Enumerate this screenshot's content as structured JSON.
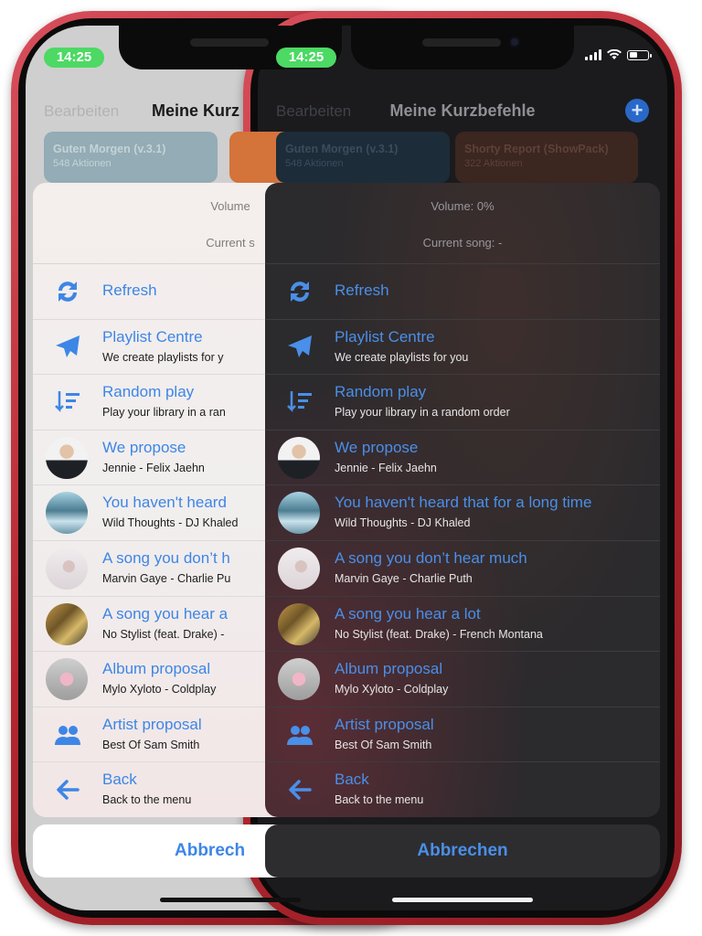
{
  "colors": {
    "accent": "#3d86e6",
    "phone_frame": "#c0303a",
    "time_pill": "#4cd964"
  },
  "status_bar": {
    "time": "14:25"
  },
  "nav": {
    "edit_label": "Bearbeiten",
    "title_dark": "Meine Kurzbefehle",
    "title_light": "Meine Kurz",
    "plus_icon": "+"
  },
  "tiles": [
    {
      "title": "Guten Morgen (v.3.1)",
      "subtitle": "548 Aktionen"
    },
    {
      "title": "Shorty Report (ShowPack)",
      "subtitle": "322 Aktionen"
    }
  ],
  "info": {
    "volume": "Volume: 0%",
    "volume_light": "Volume",
    "current_song": "Current song:  -",
    "current_song_light": "Current s"
  },
  "rows_dark": [
    {
      "icon": "refresh-icon",
      "title": "Refresh",
      "subtitle": ""
    },
    {
      "icon": "paper-plane-icon",
      "title": "Playlist Centre",
      "subtitle": "We create playlists for you"
    },
    {
      "icon": "sort-descending-icon",
      "title": "Random play",
      "subtitle": "Play your library in a random order"
    },
    {
      "icon": "avatar",
      "title": "We propose",
      "subtitle": "Jennie - Felix Jaehn"
    },
    {
      "icon": "avatar",
      "title": "You haven't heard that for a long time",
      "subtitle": "Wild Thoughts  - DJ Khaled"
    },
    {
      "icon": "avatar",
      "title": "A song you don’t hear much",
      "subtitle": "Marvin Gaye - Charlie Puth"
    },
    {
      "icon": "avatar",
      "title": "A song you hear a lot",
      "subtitle": "No Stylist (feat. Drake) - French Montana"
    },
    {
      "icon": "avatar",
      "title": "Album proposal",
      "subtitle": "Mylo Xyloto - Coldplay"
    },
    {
      "icon": "users-icon",
      "title": "Artist proposal",
      "subtitle": "Best Of Sam Smith"
    },
    {
      "icon": "arrow-left-icon",
      "title": "Back",
      "subtitle": "Back to the menu"
    }
  ],
  "rows_light": [
    {
      "title": "Refresh",
      "subtitle": ""
    },
    {
      "title": "Playlist Centre",
      "subtitle": "We create playlists for y"
    },
    {
      "title": "Random play",
      "subtitle": "Play your library in a ran"
    },
    {
      "title": "We propose",
      "subtitle": "Jennie - Felix Jaehn"
    },
    {
      "title": "You haven't heard",
      "subtitle": "Wild Thoughts  - DJ Khaled"
    },
    {
      "title": "A song you don’t h",
      "subtitle": "Marvin Gaye - Charlie Pu"
    },
    {
      "title": "A song you hear a",
      "subtitle": "No Stylist (feat. Drake) -"
    },
    {
      "title": "Album proposal",
      "subtitle": "Mylo Xyloto - Coldplay"
    },
    {
      "title": "Artist proposal",
      "subtitle": "Best Of Sam Smith"
    },
    {
      "title": "Back",
      "subtitle": "Back to the menu"
    }
  ],
  "cancel": {
    "label": "Abbrechen",
    "label_light": "Abbrech"
  }
}
